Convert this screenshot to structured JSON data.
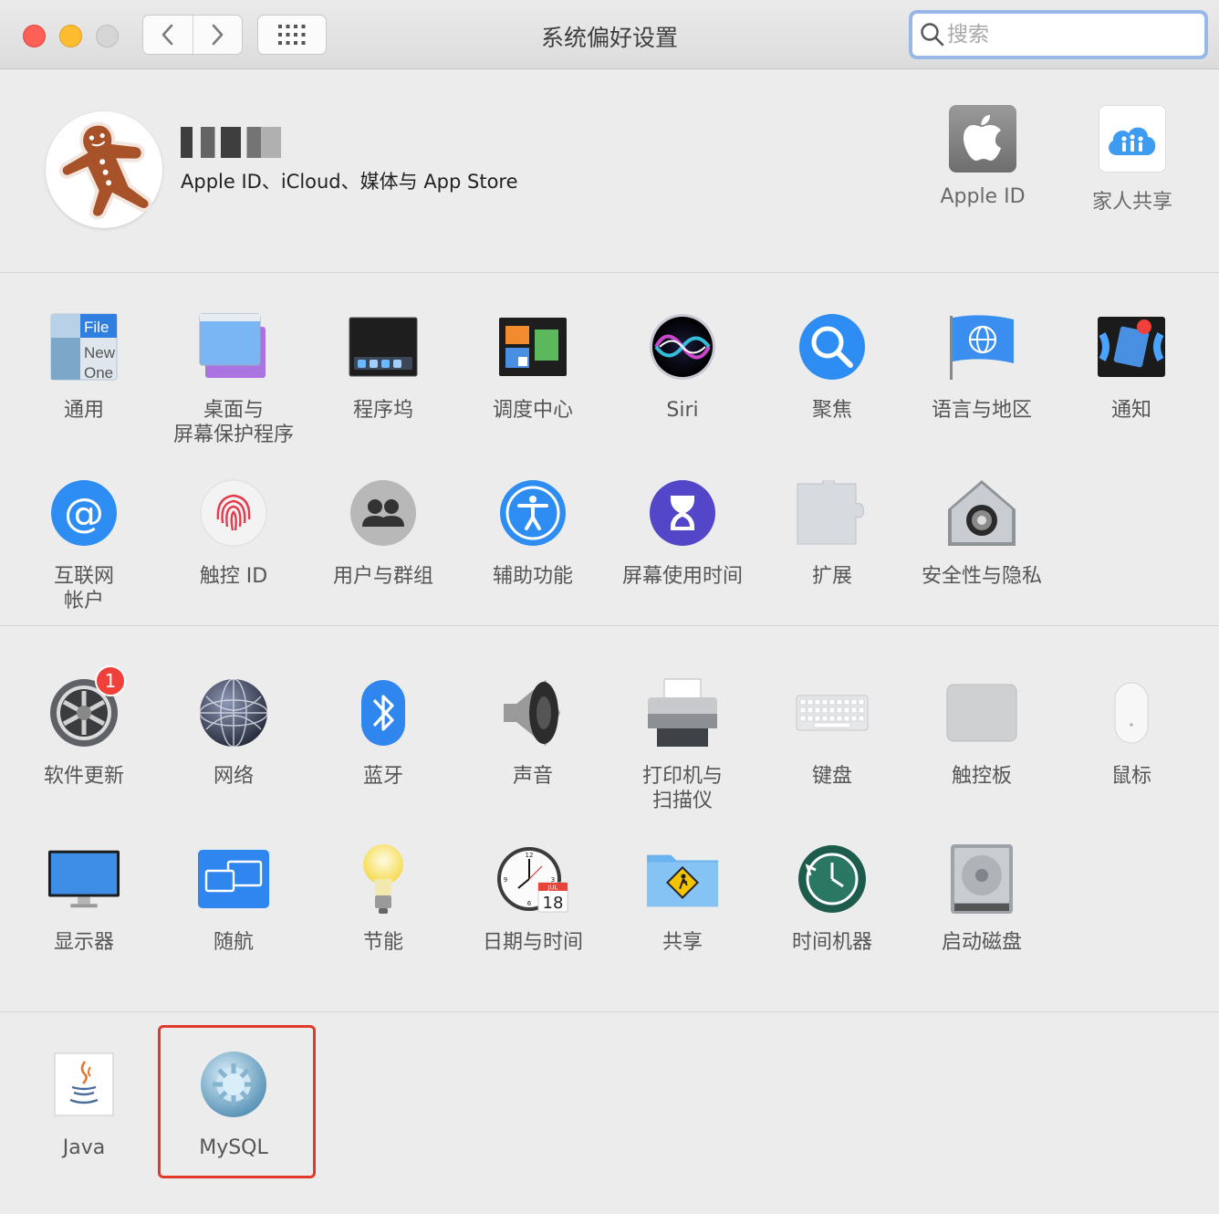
{
  "window": {
    "title": "系统偏好设置"
  },
  "search": {
    "placeholder": "搜索",
    "value": ""
  },
  "account": {
    "name": "███",
    "subtitle": "Apple ID、iCloud、媒体与 App Store",
    "tiles": [
      {
        "label": "Apple ID",
        "icon": "apple-logo-icon"
      },
      {
        "label": "家人共享",
        "icon": "family-sharing-icon"
      }
    ]
  },
  "panes_row1": [
    {
      "label": "通用",
      "icon": "general-icon"
    },
    {
      "label": "桌面与\n屏幕保护程序",
      "icon": "desktop-screensaver-icon"
    },
    {
      "label": "程序坞",
      "icon": "dock-icon"
    },
    {
      "label": "调度中心",
      "icon": "mission-control-icon"
    },
    {
      "label": "Siri",
      "icon": "siri-icon"
    },
    {
      "label": "聚焦",
      "icon": "spotlight-icon"
    },
    {
      "label": "语言与地区",
      "icon": "language-region-icon"
    },
    {
      "label": "通知",
      "icon": "notifications-icon"
    }
  ],
  "panes_row2": [
    {
      "label": "互联网\n帐户",
      "icon": "internet-accounts-icon"
    },
    {
      "label": "触控 ID",
      "icon": "touch-id-icon"
    },
    {
      "label": "用户与群组",
      "icon": "users-groups-icon"
    },
    {
      "label": "辅助功能",
      "icon": "accessibility-icon"
    },
    {
      "label": "屏幕使用时间",
      "icon": "screen-time-icon"
    },
    {
      "label": "扩展",
      "icon": "extensions-icon"
    },
    {
      "label": "安全性与隐私",
      "icon": "security-privacy-icon"
    }
  ],
  "panes_row3": [
    {
      "label": "软件更新",
      "icon": "software-update-icon",
      "badge": "1"
    },
    {
      "label": "网络",
      "icon": "network-icon"
    },
    {
      "label": "蓝牙",
      "icon": "bluetooth-icon"
    },
    {
      "label": "声音",
      "icon": "sound-icon"
    },
    {
      "label": "打印机与\n扫描仪",
      "icon": "printers-scanners-icon"
    },
    {
      "label": "键盘",
      "icon": "keyboard-icon"
    },
    {
      "label": "触控板",
      "icon": "trackpad-icon"
    },
    {
      "label": "鼠标",
      "icon": "mouse-icon"
    }
  ],
  "panes_row4": [
    {
      "label": "显示器",
      "icon": "displays-icon"
    },
    {
      "label": "随航",
      "icon": "sidecar-icon"
    },
    {
      "label": "节能",
      "icon": "energy-saver-icon"
    },
    {
      "label": "日期与时间",
      "icon": "date-time-icon",
      "clock_month": "JUL",
      "clock_day": "18"
    },
    {
      "label": "共享",
      "icon": "sharing-icon"
    },
    {
      "label": "时间机器",
      "icon": "time-machine-icon"
    },
    {
      "label": "启动磁盘",
      "icon": "startup-disk-icon"
    }
  ],
  "panes_other": [
    {
      "label": "Java",
      "icon": "java-icon"
    },
    {
      "label": "MySQL",
      "icon": "mysql-icon"
    }
  ],
  "colors": {
    "highlight": "#e2392b",
    "search_focus": "#98b8e8",
    "badge": "#f0403a"
  }
}
